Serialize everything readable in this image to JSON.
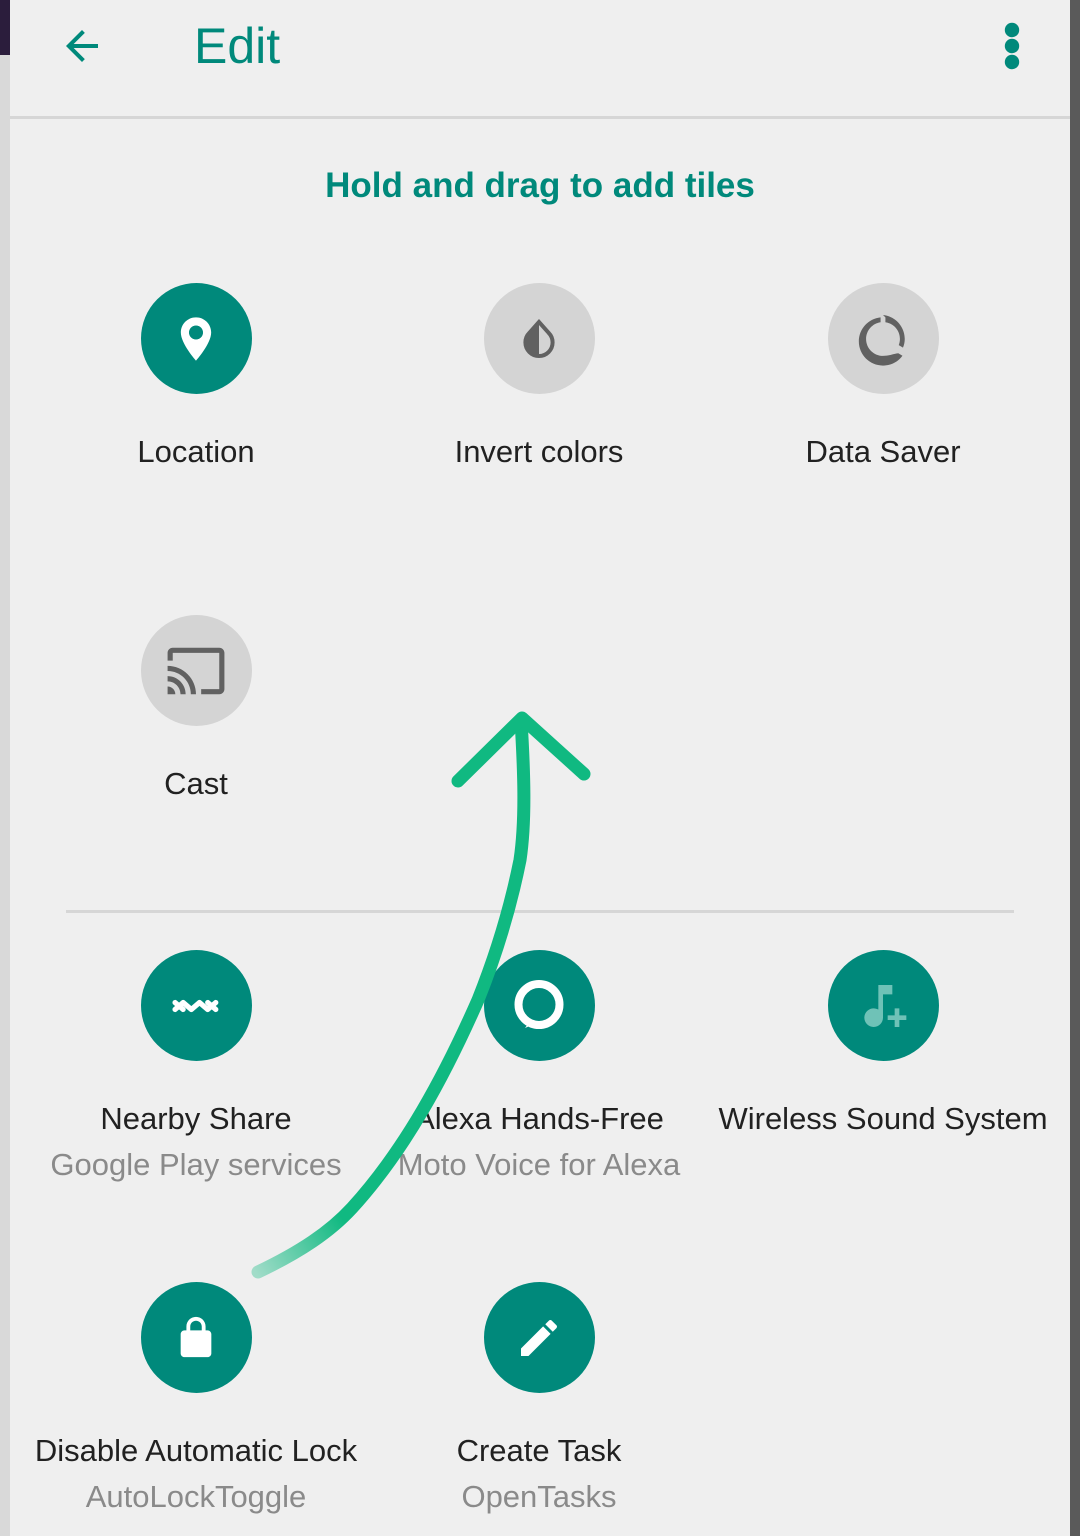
{
  "appbar": {
    "title": "Edit",
    "back_icon": "arrow-back-icon",
    "more_icon": "more-vert-icon"
  },
  "hint": "Hold and drag to add tiles",
  "active_tiles": [
    {
      "label": "Location",
      "icon": "location-pin-icon",
      "state": "on"
    },
    {
      "label": "Invert colors",
      "icon": "invert-colors-icon",
      "state": "off"
    },
    {
      "label": "Data Saver",
      "icon": "data-saver-icon",
      "state": "off"
    },
    {
      "label": "Cast",
      "icon": "cast-icon",
      "state": "off"
    }
  ],
  "available_tiles": [
    {
      "label": "Nearby Share",
      "sub": "Google Play services",
      "icon": "nearby-share-icon"
    },
    {
      "label": "Alexa Hands-Free",
      "sub": "Moto Voice for Alexa",
      "icon": "alexa-icon"
    },
    {
      "label": "Wireless Sound System",
      "sub": "",
      "icon": "music-note-add-icon"
    },
    {
      "label": "Disable Automatic Lock",
      "sub": "AutoLockToggle",
      "icon": "lock-icon"
    },
    {
      "label": "Create Task",
      "sub": "OpenTasks",
      "icon": "pencil-icon"
    }
  ],
  "colors": {
    "accent": "#00897b",
    "tile_off": "#d4d4d4",
    "annotation_arrow": "#10b981"
  }
}
